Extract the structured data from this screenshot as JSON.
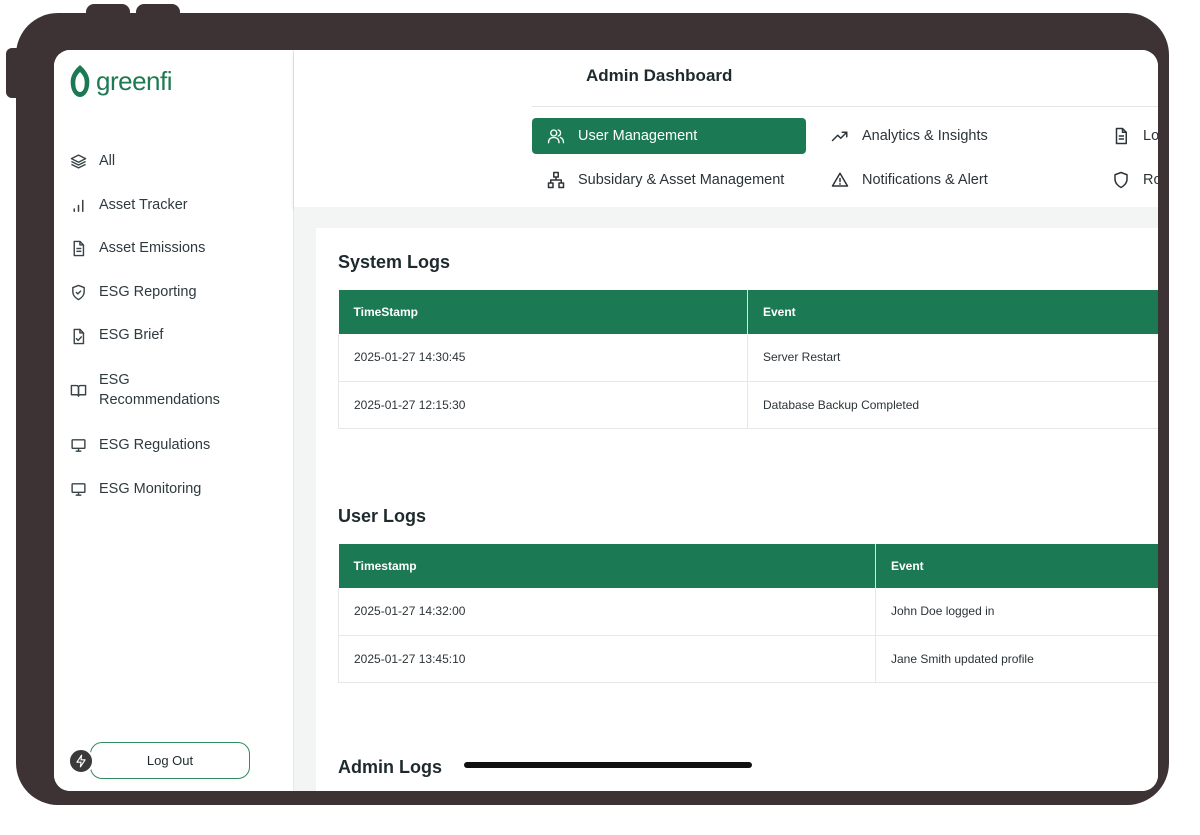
{
  "brand": {
    "name": "greenfi",
    "color": "#1b7a53"
  },
  "sidebar": {
    "items": [
      {
        "label": "All",
        "icon": "layers-icon"
      },
      {
        "label": "Asset Tracker",
        "icon": "bar-chart-icon"
      },
      {
        "label": "Asset Emissions",
        "icon": "document-icon"
      },
      {
        "label": "ESG Reporting",
        "icon": "shield-check-icon"
      },
      {
        "label": "ESG Brief",
        "icon": "file-check-icon"
      },
      {
        "label": "ESG Recommendations",
        "icon": "book-open-icon"
      },
      {
        "label": "ESG Regulations",
        "icon": "monitor-icon"
      },
      {
        "label": "ESG Monitoring",
        "icon": "monitor-icon"
      }
    ],
    "logout_label": "Log Out"
  },
  "header": {
    "title": "Admin Dashboard",
    "tabs": [
      {
        "label": "User Management",
        "icon": "users-icon",
        "active": true
      },
      {
        "label": "Analytics & Insights",
        "icon": "trending-up-icon"
      },
      {
        "label": "Lo",
        "icon": "document-icon"
      },
      {
        "label": "Subsidary & Asset Management",
        "icon": "hierarchy-icon"
      },
      {
        "label": "Notifications & Alert",
        "icon": "alert-triangle-icon"
      },
      {
        "label": "Ro",
        "icon": "shield-icon"
      }
    ]
  },
  "system_logs": {
    "title": "System Logs",
    "columns": [
      "TimeStamp",
      "Event"
    ],
    "rows": [
      [
        "2025-01-27 14:30:45",
        "Server Restart"
      ],
      [
        "2025-01-27 12:15:30",
        "Database Backup Completed"
      ]
    ]
  },
  "user_logs": {
    "title": "User Logs",
    "columns": [
      "Timestamp",
      "Event"
    ],
    "rows": [
      [
        "2025-01-27 14:32:00",
        "John Doe logged in"
      ],
      [
        "2025-01-27 13:45:10",
        "Jane Smith updated profile"
      ]
    ]
  },
  "admin_logs": {
    "title": "Admin Logs"
  }
}
